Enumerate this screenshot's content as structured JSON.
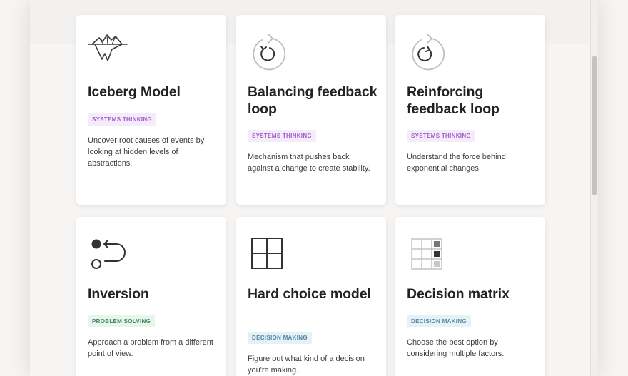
{
  "cards": [
    {
      "title": "Iceberg Model",
      "tag": "SYSTEMS THINKING",
      "description": "Uncover root causes of events by looking at hidden levels of abstractions.",
      "icon": "iceberg-icon"
    },
    {
      "title": "Balancing feedback loop",
      "tag": "SYSTEMS THINKING",
      "description": "Mechanism that pushes back against a change to create stability.",
      "icon": "balancing-loop-icon"
    },
    {
      "title": "Reinforcing feedback loop",
      "tag": "SYSTEMS THINKING",
      "description": "Understand the force behind exponential changes.",
      "icon": "reinforcing-loop-icon"
    },
    {
      "title": "Inversion",
      "tag": "PROBLEM SOLVING",
      "description": "Approach a problem from a different point of view.",
      "icon": "inversion-icon"
    },
    {
      "title": "Hard choice model",
      "tag": "DECISION MAKING",
      "description": "Figure out what kind of a decision you're making.",
      "icon": "grid-icon"
    },
    {
      "title": "Decision matrix",
      "tag": "DECISION MAKING",
      "description": "Choose the best option by considering multiple factors.",
      "icon": "decision-matrix-icon"
    }
  ],
  "colors": {
    "systems_thinking": "#a45bc6",
    "problem_solving": "#3c8a57",
    "decision_making": "#4e87a5"
  }
}
